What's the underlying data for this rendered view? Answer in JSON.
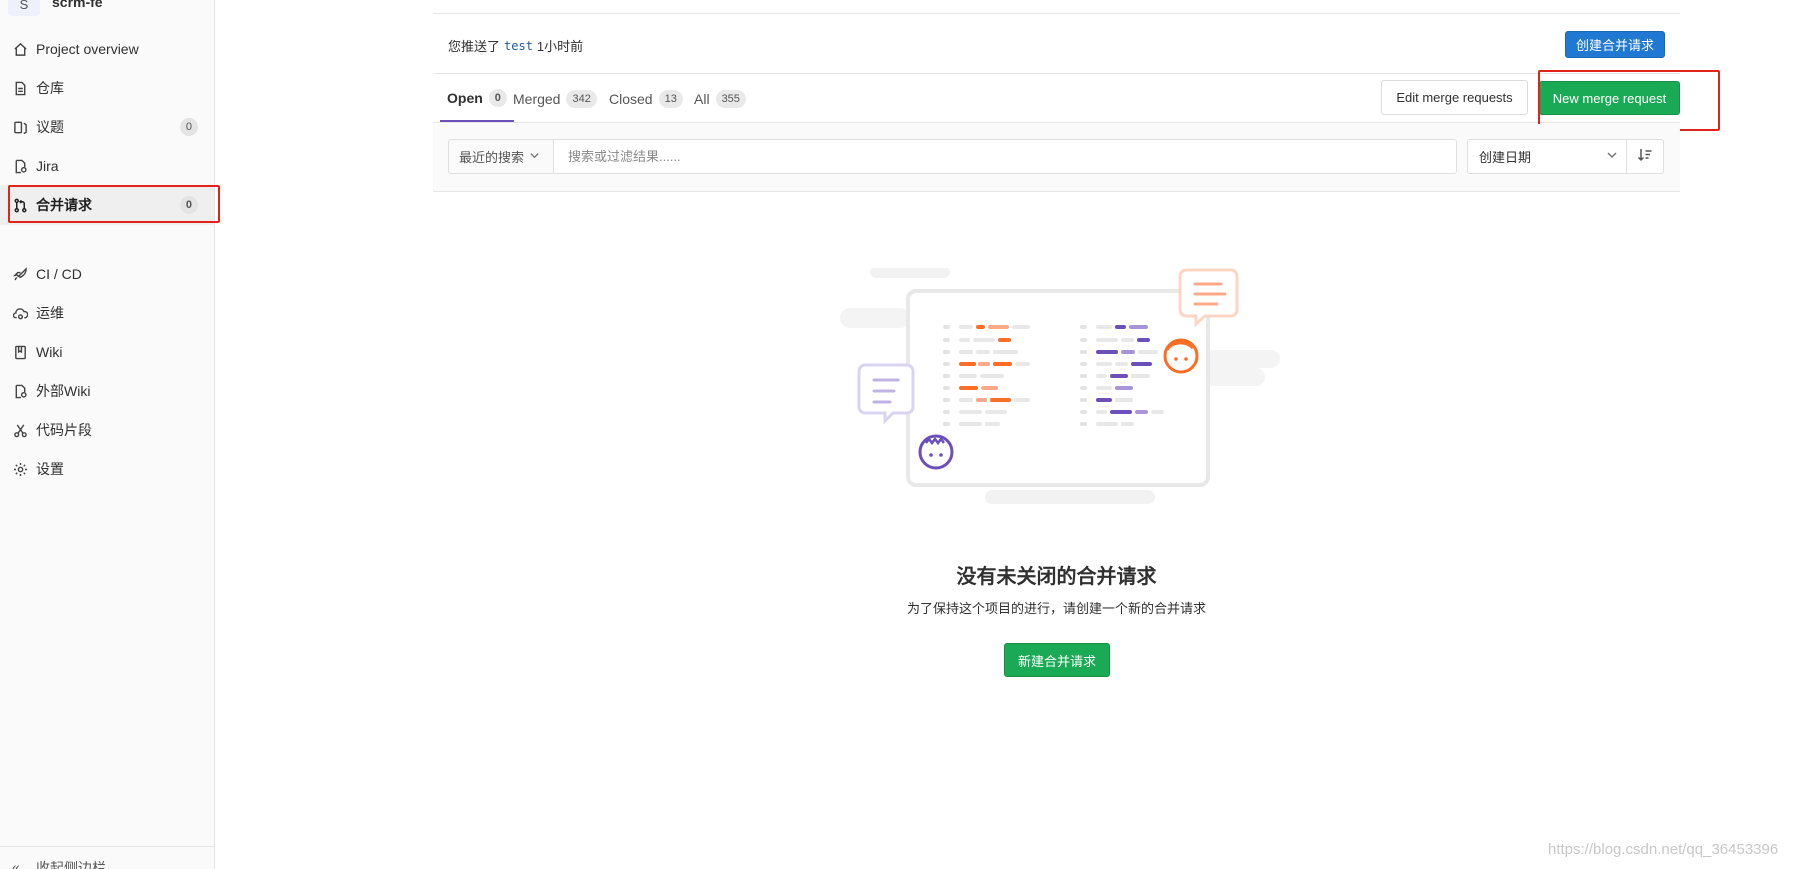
{
  "sidebar": {
    "project_avatar": "S",
    "project_name": "scrm-fe",
    "items": [
      {
        "label": "Project overview",
        "icon": "home-icon"
      },
      {
        "label": "仓库",
        "icon": "document-icon"
      },
      {
        "label": "议题",
        "icon": "issues-icon",
        "count": "0"
      },
      {
        "label": "Jira",
        "icon": "jira-icon"
      },
      {
        "label": "合并请求",
        "icon": "merge-request-icon",
        "count": "0",
        "active": true
      },
      {
        "label": "CI / CD",
        "icon": "rocket-icon"
      },
      {
        "label": "运维",
        "icon": "cloud-gear-icon"
      },
      {
        "label": "Wiki",
        "icon": "book-icon"
      },
      {
        "label": "外部Wiki",
        "icon": "external-wiki-icon"
      },
      {
        "label": "代码片段",
        "icon": "scissors-icon"
      },
      {
        "label": "设置",
        "icon": "settings-icon"
      }
    ],
    "collapse_label": "收起侧边栏"
  },
  "push_notice": {
    "prefix": "您推送了",
    "branch": "test",
    "time": "1小时前",
    "create_button": "创建合并请求"
  },
  "tabs": [
    {
      "label": "Open",
      "count": "0",
      "active": true
    },
    {
      "label": "Merged",
      "count": "342"
    },
    {
      "label": "Closed",
      "count": "13"
    },
    {
      "label": "All",
      "count": "355"
    }
  ],
  "actions": {
    "edit_label": "Edit merge requests",
    "new_label": "New merge request"
  },
  "filter": {
    "recent_label": "最近的搜索",
    "placeholder": "搜索或过滤结果......",
    "sort_label": "创建日期"
  },
  "empty_state": {
    "title": "没有未关闭的合并请求",
    "subtitle": "为了保持这个项目的进行，请创建一个新的合并请求",
    "button": "新建合并请求"
  },
  "watermark": "https://blog.csdn.net/qq_36453396",
  "colors": {
    "primary_blue": "#1f78d1",
    "success_green": "#1aaa55",
    "tab_active_underline": "#6b4fbb",
    "highlight_red": "#e2231a"
  }
}
